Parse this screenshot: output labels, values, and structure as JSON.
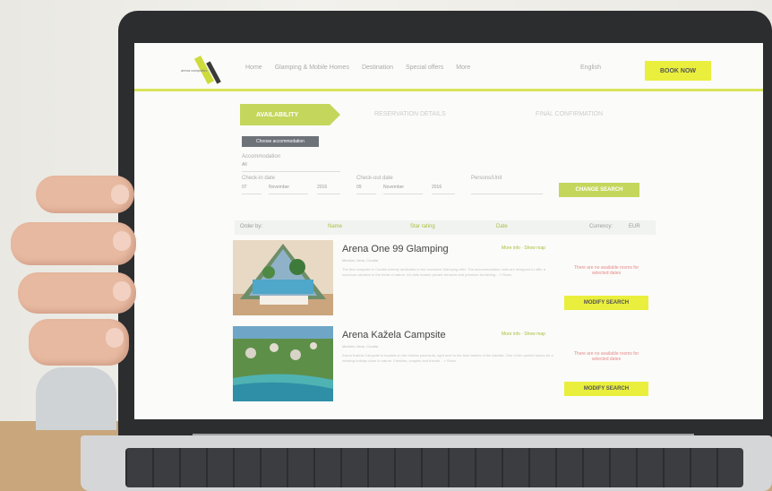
{
  "brand": {
    "logo_text": "arena campsites"
  },
  "nav": {
    "links": [
      "Home",
      "Glamping & Mobile Homes",
      "Destination",
      "Special offers",
      "More"
    ],
    "language": "English",
    "book_now": "BOOK NOW"
  },
  "steps": [
    "AVAILABILITY",
    "RESERVATION DETAILS",
    "FINAL CONFIRMATION"
  ],
  "search": {
    "choose_button": "Choose accommodation",
    "accommodation_label": "Accommodation",
    "accommodation_value": "All",
    "checkin_label": "Check-in date",
    "checkin": {
      "day": "07",
      "month": "November",
      "year": "2016"
    },
    "checkout_label": "Check-out date",
    "checkout": {
      "day": "09",
      "month": "November",
      "year": "2016"
    },
    "persons_label": "Persons/Unit",
    "change_button": "CHANGE SEARCH"
  },
  "sort": {
    "order_by": "Order by:",
    "options": [
      "Name",
      "Star rating",
      "Date"
    ],
    "currency_label": "Currency:",
    "currency_value": "EUR"
  },
  "results": [
    {
      "title": "Arena One 99 Glamping",
      "subtitle": "Medulin, Istria, Croatia",
      "description": "The first campsite in Croatia entirely dedicated to the exclusive Glamping offer. The accommodation units are designed to offer a luxurious vacation in the heart of nature. All units feature private terraces and premium furnishing... » Show",
      "links": "More info · Show map",
      "note": "There are no available rooms for selected dates",
      "button": "MODIFY SEARCH"
    },
    {
      "title": "Arena Kažela Campsite",
      "subtitle": "Medulin, Istria, Croatia",
      "description": "Arena Kažela Campsite is located on the Kažela peninsula, right next to the blue waters of the Adriatic. One of the perfect bases for a relaxing holiday close to nature. Families, couples and friends... » Show",
      "links": "More info · Show map",
      "note": "There are no available rooms for selected dates",
      "button": "MODIFY SEARCH"
    }
  ],
  "colors": {
    "accent": "#c5d65c",
    "button_yellow": "#e9ef3c",
    "bezel": "#2b2d2f"
  }
}
